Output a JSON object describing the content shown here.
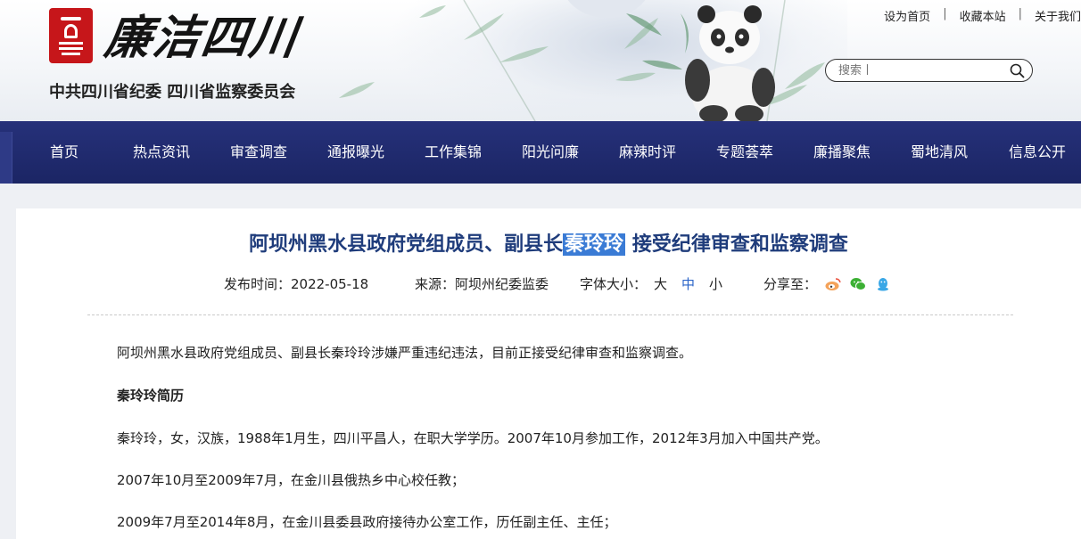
{
  "header": {
    "logo_text": "廉洁四川",
    "org_name": "中共四川省纪委 四川省监察委员会",
    "top_links": [
      "设为首页",
      "收藏本站",
      "关于我们"
    ],
    "search_placeholder": "搜索丨"
  },
  "nav": {
    "items": [
      "首页",
      "热点资讯",
      "审查调查",
      "通报曝光",
      "工作集锦",
      "阳光问廉",
      "麻辣时评",
      "专题荟萃",
      "廉播聚焦",
      "蜀地清风",
      "信息公开"
    ]
  },
  "article": {
    "title_before": "阿坝州黑水县政府党组成员、副县长",
    "title_highlight": "秦玲玲",
    "title_after": " 接受纪律审查和监察调查",
    "publish_label": "发布时间：2022-05-18",
    "source_label": "来源：阿坝州纪委监委",
    "font_size_label": "字体大小：",
    "font_sizes": [
      "大",
      "中",
      "小"
    ],
    "share_label": "分享至：",
    "share_icons": [
      "weibo-icon",
      "wechat-icon",
      "qq-icon"
    ],
    "paragraphs": [
      "阿坝州黑水县政府党组成员、副县长秦玲玲涉嫌严重违纪违法，目前正接受纪律审查和监察调查。",
      "秦玲玲简历",
      "秦玲玲，女，汉族，1988年1月生，四川平昌人，在职大学学历。2007年10月参加工作，2012年3月加入中国共产党。",
      "2007年10月至2009年7月，在金川县俄热乡中心校任教；",
      "2009年7月至2014年8月，在金川县委县政府接待办公室工作，历任副主任、主任；"
    ]
  },
  "colors": {
    "nav_bg": "#1c2767",
    "title": "#1f3c7b",
    "highlight": "#3a7bd5",
    "seal_red": "#c6161a"
  }
}
